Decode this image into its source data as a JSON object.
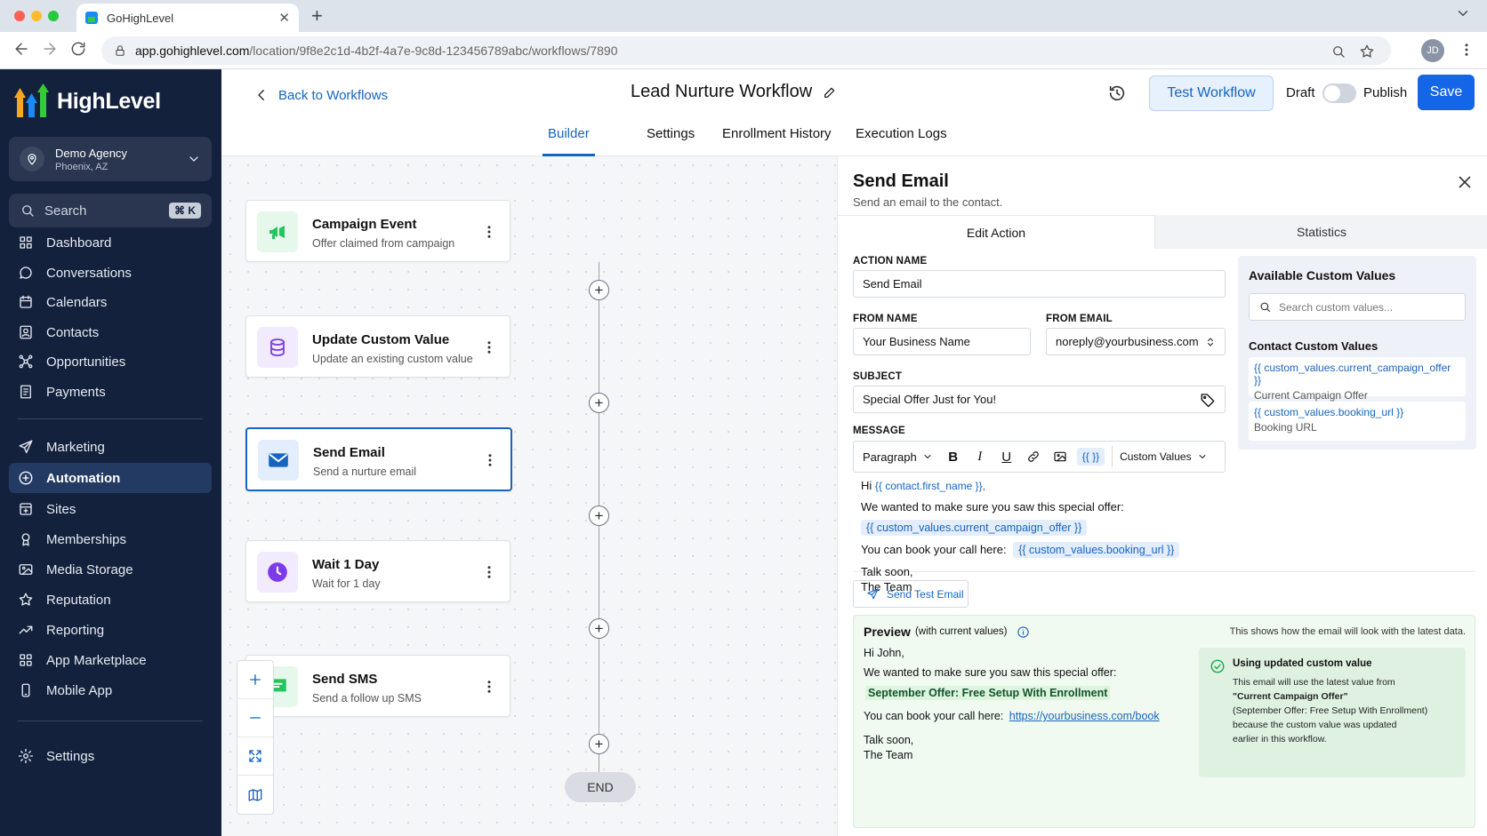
{
  "browser": {
    "tab_title": "GoHighLevel",
    "url_host": "app.gohighlevel.com",
    "url_path": "/location/9f8e2c1d-4b2f-4a7e-9c8d-123456789abc/workflows/7890",
    "avatar_initials": "JD"
  },
  "sidebar": {
    "logo_text": "HighLevel",
    "agency_name": "Demo Agency",
    "agency_location": "Phoenix, AZ",
    "search_label": "Search",
    "search_shortcut": "⌘ K",
    "items": [
      {
        "label": "Dashboard",
        "icon": "grid-icon"
      },
      {
        "label": "Conversations",
        "icon": "chat-icon"
      },
      {
        "label": "Calendars",
        "icon": "calendar-icon"
      },
      {
        "label": "Contacts",
        "icon": "contacts-icon"
      },
      {
        "label": "Opportunities",
        "icon": "opportunities-icon"
      },
      {
        "label": "Payments",
        "icon": "payments-icon"
      },
      {
        "label": "Marketing",
        "icon": "send-icon"
      },
      {
        "label": "Automation",
        "icon": "automation-icon",
        "active": true
      },
      {
        "label": "Sites",
        "icon": "sites-icon"
      },
      {
        "label": "Memberships",
        "icon": "memberships-icon"
      },
      {
        "label": "Media Storage",
        "icon": "image-icon"
      },
      {
        "label": "Reputation",
        "icon": "star-icon"
      },
      {
        "label": "Reporting",
        "icon": "trend-icon"
      },
      {
        "label": "App Marketplace",
        "icon": "apps-icon"
      },
      {
        "label": "Mobile App",
        "icon": "mobile-icon"
      }
    ],
    "settings_label": "Settings"
  },
  "header": {
    "back_label": "Back to Workflows",
    "title": "Lead Nurture Workflow",
    "test_label": "Test Workflow",
    "draft_label": "Draft",
    "publish_label": "Publish",
    "save_label": "Save",
    "published": false
  },
  "subtabs": [
    "Builder",
    "Settings",
    "Enrollment History",
    "Execution Logs"
  ],
  "active_subtab": "Builder",
  "workflow": {
    "nodes": [
      {
        "title": "Campaign Event",
        "subtitle": "Offer claimed from campaign",
        "icon": "megaphone-icon",
        "color": "#22c55e"
      },
      {
        "title": "Update Custom Value",
        "subtitle": "Update an existing custom value",
        "icon": "database-icon",
        "color": "#7c3aed"
      },
      {
        "title": "Send Email",
        "subtitle": "Send a nurture email",
        "icon": "mail-icon",
        "color": "#1565c0",
        "selected": true
      },
      {
        "title": "Wait 1 Day",
        "subtitle": "Wait for 1 day",
        "icon": "clock-icon",
        "color": "#7c3aed"
      },
      {
        "title": "Send SMS",
        "subtitle": "Send a follow up SMS",
        "icon": "sms-icon",
        "color": "#22c55e"
      }
    ],
    "end_label": "END",
    "zoom_controls": [
      "zoom-in-icon",
      "zoom-out-icon",
      "fit-icon",
      "map-icon"
    ]
  },
  "panel": {
    "title": "Send Email",
    "subtitle": "Send an email to the contact.",
    "tabs": [
      "Edit Action",
      "Statistics"
    ],
    "active_tab": "Edit Action",
    "action_name_label": "ACTION NAME",
    "action_name": "Send Email",
    "from_name_label": "FROM NAME",
    "from_name": "Your Business Name",
    "from_email_label": "FROM EMAIL",
    "from_email": "noreply@yourbusiness.com",
    "subject_label": "SUBJECT",
    "subject": "Special Offer Just for You!",
    "message_label": "MESSAGE",
    "toolbar": {
      "paragraph": "Paragraph",
      "buttons": [
        "B",
        "I",
        "U"
      ],
      "custom_values_toggle": "{{ }}",
      "custom_values_menu": "Custom Values"
    },
    "message": {
      "greeting": "Hi",
      "greeting_token": "{{ contact.first_name }},",
      "line1": "We wanted to make sure you saw this special offer:",
      "offer_token": "{{ custom_values.current_campaign_offer }}",
      "line2": "You can book your call here:",
      "booking_token": "{{ custom_values.booking_url }}",
      "signoff1": "Talk soon,",
      "signoff2": "The Team"
    },
    "send_test_label": "Send Test Email",
    "custom_values": {
      "title": "Available Custom Values",
      "search_placeholder": "Search custom values...",
      "section": "Contact Custom Values",
      "items": [
        {
          "token": "{{ custom_values.current_campaign_offer }}",
          "name": "Current Campaign Offer"
        },
        {
          "token": "{{ custom_values.booking_url }}",
          "name": "Booking URL"
        }
      ]
    },
    "preview": {
      "title": "Preview",
      "qualifier": "(with current values)",
      "note": "This shows how the email will look with the latest data.",
      "greeting": "Hi John,",
      "line1": "We wanted to make sure you saw this special offer:",
      "offer": "September Offer: Free Setup With Enrollment",
      "line2": "You can book your call here:",
      "link": "https://yourbusiness.com/book",
      "signoff1": "Talk soon,",
      "signoff2": "The Team",
      "info_title": "Using updated custom value",
      "info_line1": "This email will use the latest value from",
      "info_bold": "\"Current Campaign Offer\"",
      "info_line2": "(September Offer: Free Setup With Enrollment)",
      "info_line3": "because the custom value was updated",
      "info_line4": "earlier in this workflow."
    }
  }
}
